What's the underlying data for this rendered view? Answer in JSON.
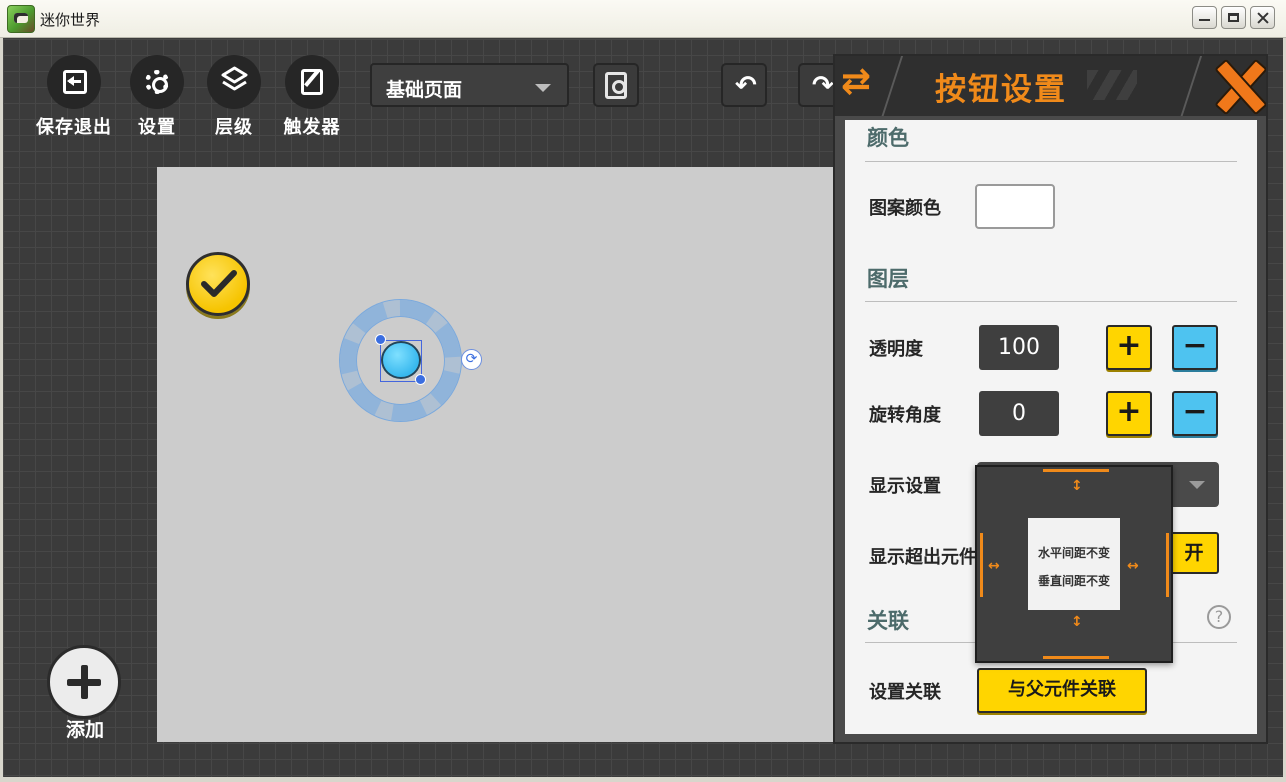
{
  "window": {
    "title": "迷你世界"
  },
  "toolbar": {
    "save_exit": "保存退出",
    "settings": "设置",
    "layers": "层级",
    "triggers": "触发器",
    "page_select": "基础页面"
  },
  "canvas": {
    "add_label": "添加"
  },
  "panel": {
    "title": "按钮设置",
    "color_section": "颜色",
    "pattern_color_label": "图案颜色",
    "layer_section": "图层",
    "opacity_label": "透明度",
    "opacity_value": "100",
    "rotation_label": "旋转角度",
    "rotation_value": "0",
    "display_label": "显示设置",
    "overflow_label": "显示超出元件",
    "overflow_btn": "开",
    "link_section": "关联",
    "link_label": "设置关联",
    "link_btn": "与父元件关联",
    "plus_glyph": "+",
    "minus_glyph": "−",
    "help_glyph": "?"
  },
  "anchor_popup": {
    "line1": "水平间距不变",
    "line2": "垂直间距不变"
  },
  "colors": {
    "accent_orange": "#f08a1a",
    "yellow_button": "#ffd500",
    "blue_button": "#4ec3f0"
  }
}
